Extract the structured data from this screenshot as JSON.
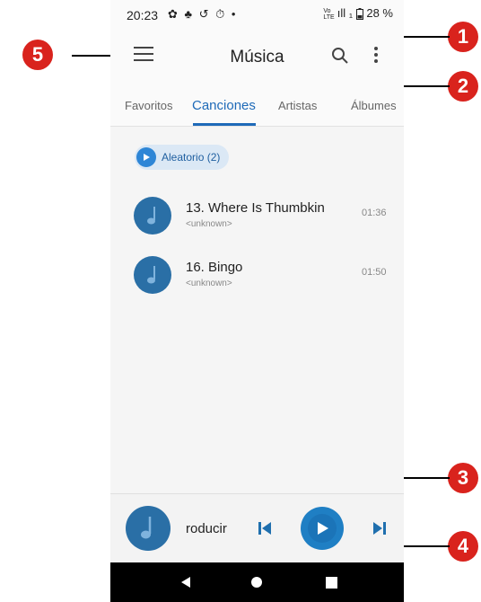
{
  "status": {
    "time": "20:23",
    "icons": "✿ ♣ ↺ ⏱ •",
    "lte_top": "Vo",
    "lte_bottom": "LTE",
    "signal": "ıll ₁",
    "battery": "28 %"
  },
  "appbar": {
    "title": "Música"
  },
  "tabs": [
    {
      "label": "Favoritos"
    },
    {
      "label": "Canciones",
      "active": true
    },
    {
      "label": "Artistas"
    },
    {
      "label": "Álbumes"
    }
  ],
  "shuffle": {
    "label": "Aleatorio (2)"
  },
  "songs": [
    {
      "title": "13. Where Is Thumbkin",
      "artist": "<unknown>",
      "duration": "01:36"
    },
    {
      "title": "16. Bingo",
      "artist": "<unknown>",
      "duration": "01:50"
    }
  ],
  "player": {
    "label": "roducir"
  },
  "callouts": [
    "1",
    "2",
    "3",
    "4",
    "5"
  ],
  "colors": {
    "accent": "#1e6ab8",
    "callout": "#d9231d",
    "art": "#2a6fa6"
  }
}
